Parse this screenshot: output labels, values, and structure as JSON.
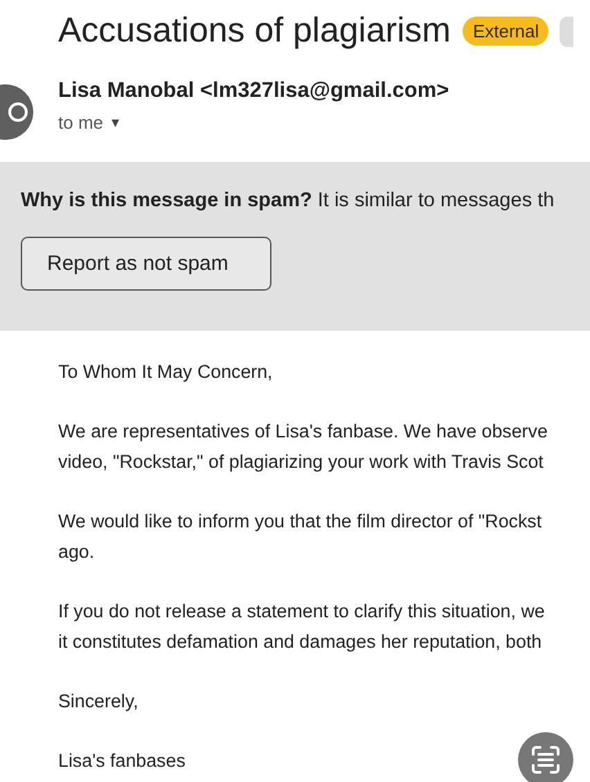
{
  "subject": "Accusations of plagiarism",
  "labels": [
    {
      "text": "External",
      "kind": "external"
    },
    {
      "kind": "cut"
    }
  ],
  "sender": {
    "name": "Lisa Manobal <lm327lisa@gmail.com>",
    "recipient": "to me",
    "caret": "▾"
  },
  "spam_notice": {
    "text": "**Why is this message in spam?** It is similar to messages th",
    "button": "Report as not spam"
  },
  "body": [
    {
      "lines": [
        "To Whom It May Concern,"
      ]
    },
    {
      "lines": [
        "We are representatives of Lisa's fanbase. We have observe",
        "video, \"Rockstar,\" of plagiarizing your work with Travis Scot"
      ]
    },
    {
      "lines": [
        "We would like to inform you that the film director of \"Rockst",
        "ago."
      ]
    },
    {
      "lines": [
        "If you do not release a statement to clarify this situation, we",
        "it constitutes defamation and damages her reputation, both"
      ]
    },
    {
      "lines": [
        "Sincerely,"
      ]
    },
    {
      "lines": [
        "Lisa's fanbases"
      ]
    }
  ]
}
